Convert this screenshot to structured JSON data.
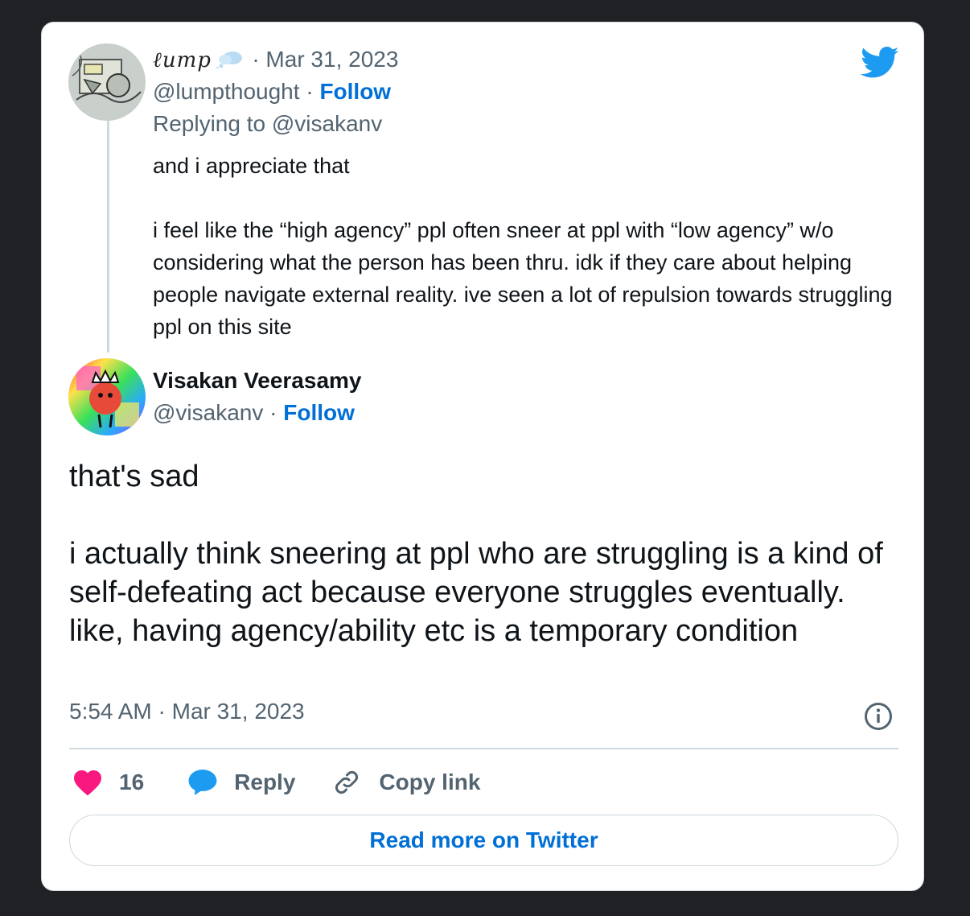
{
  "colors": {
    "background": "#202124",
    "card": "#ffffff",
    "link_blue": "#006fd6",
    "twitter_blue": "#1d9bf0",
    "heart_pink": "#f91880",
    "muted": "#536471"
  },
  "reply_tweet": {
    "display_name": "ℓump",
    "bubble_icon": "thought-bubble-emoji",
    "date": "· Mar 31, 2023",
    "handle": "@lumpthought",
    "separator": " · ",
    "follow_label": "Follow",
    "replying_to": "Replying to @visakanv",
    "text_line1": "and i appreciate that",
    "text_para2": "i feel like the “high agency” ppl often sneer at ppl with “low agency” w/o considering what the person has been thru. idk if they care about helping people navigate external reality. ive seen a lot of repulsion towards struggling ppl on this site"
  },
  "main_tweet": {
    "display_name": "Visakan Veerasamy",
    "handle": "@visakanv",
    "separator": " · ",
    "follow_label": "Follow",
    "text_para1": "that's sad",
    "text_para2": "i actually think sneering at ppl who are struggling is a kind of self-defeating act because everyone struggles eventually. like, having agency/ability etc is a temporary condition",
    "timestamp": "5:54 AM · Mar 31, 2023"
  },
  "actions": {
    "like_count": "16",
    "reply_label": "Reply",
    "copy_link_label": "Copy link"
  },
  "read_more_label": "Read more on Twitter",
  "icons": [
    "twitter-bird-icon",
    "info-icon",
    "heart-icon",
    "reply-bubble-icon",
    "link-icon"
  ]
}
